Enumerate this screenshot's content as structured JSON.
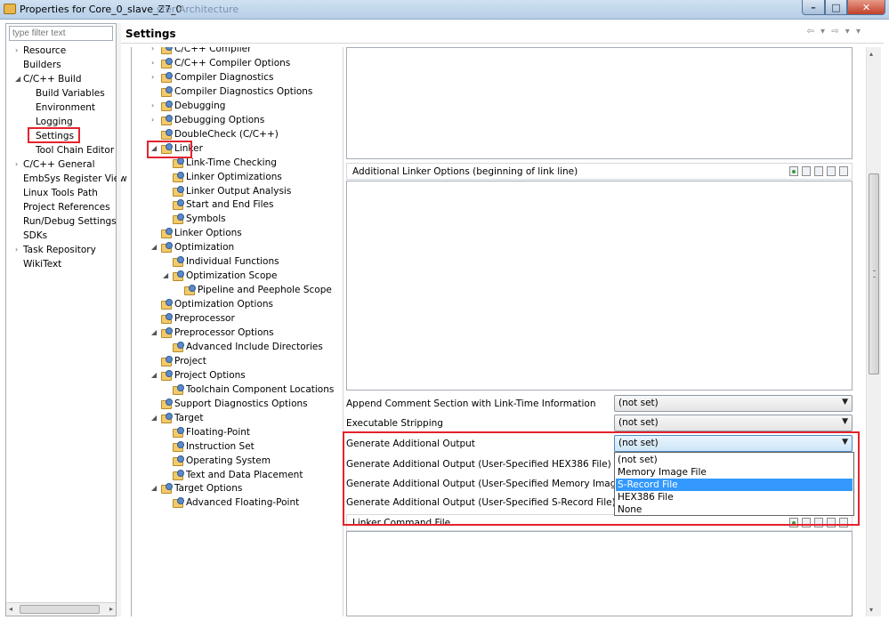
{
  "window": {
    "title": "Properties for Core_0_slave_Z7_0",
    "title_ghost": "ster Architecture",
    "min_glyph": "–",
    "max_glyph": "□",
    "close_glyph": "✕"
  },
  "filter": {
    "placeholder": "type filter text"
  },
  "nav_tree": [
    {
      "label": "Resource",
      "twisty": "›"
    },
    {
      "label": "Builders",
      "twisty": ""
    },
    {
      "label": "C/C++ Build",
      "twisty": "◢"
    },
    {
      "label": "Build Variables",
      "twisty": ""
    },
    {
      "label": "Environment",
      "twisty": ""
    },
    {
      "label": "Logging",
      "twisty": ""
    },
    {
      "label": "Settings",
      "twisty": "",
      "selected": true
    },
    {
      "label": "Tool Chain Editor",
      "twisty": ""
    },
    {
      "label": "C/C++ General",
      "twisty": "›"
    },
    {
      "label": "EmbSys Register View",
      "twisty": ""
    },
    {
      "label": "Linux Tools Path",
      "twisty": ""
    },
    {
      "label": "Project References",
      "twisty": ""
    },
    {
      "label": "Run/Debug Settings",
      "twisty": ""
    },
    {
      "label": "SDKs",
      "twisty": ""
    },
    {
      "label": "Task Repository",
      "twisty": "›"
    },
    {
      "label": "WikiText",
      "twisty": ""
    }
  ],
  "left_hscroll": {
    "left": "◂",
    "right": "▸"
  },
  "settings": {
    "title": "Settings",
    "nav_arrows": "⇦ ▾ ⇨ ▾ ▾"
  },
  "tool_tree": [
    {
      "label": "C/C++ Compiler",
      "twisty": "›",
      "level": 1
    },
    {
      "label": "C/C++ Compiler Options",
      "twisty": "›",
      "level": 1
    },
    {
      "label": "Compiler Diagnostics",
      "twisty": "›",
      "level": 1
    },
    {
      "label": "Compiler Diagnostics Options",
      "twisty": "",
      "level": 1
    },
    {
      "label": "Debugging",
      "twisty": "›",
      "level": 1
    },
    {
      "label": "Debugging Options",
      "twisty": "›",
      "level": 1
    },
    {
      "label": "DoubleCheck (C/C++)",
      "twisty": "",
      "level": 1
    },
    {
      "label": "Linker",
      "twisty": "◢",
      "level": 1
    },
    {
      "label": "Link-Time Checking",
      "twisty": "",
      "level": 2
    },
    {
      "label": "Linker Optimizations",
      "twisty": "",
      "level": 2
    },
    {
      "label": "Linker Output Analysis",
      "twisty": "",
      "level": 2
    },
    {
      "label": "Start and End Files",
      "twisty": "",
      "level": 2
    },
    {
      "label": "Symbols",
      "twisty": "",
      "level": 2
    },
    {
      "label": "Linker Options",
      "twisty": "",
      "level": 1
    },
    {
      "label": "Optimization",
      "twisty": "◢",
      "level": 1
    },
    {
      "label": "Individual Functions",
      "twisty": "",
      "level": 2
    },
    {
      "label": "Optimization Scope",
      "twisty": "◢",
      "level": 2
    },
    {
      "label": "Pipeline and Peephole Scope",
      "twisty": "",
      "level": 3
    },
    {
      "label": "Optimization Options",
      "twisty": "",
      "level": 1
    },
    {
      "label": "Preprocessor",
      "twisty": "",
      "level": 1
    },
    {
      "label": "Preprocessor Options",
      "twisty": "◢",
      "level": 1
    },
    {
      "label": "Advanced Include Directories",
      "twisty": "",
      "level": 2
    },
    {
      "label": "Project",
      "twisty": "",
      "level": 1
    },
    {
      "label": "Project Options",
      "twisty": "◢",
      "level": 1
    },
    {
      "label": "Toolchain Component Locations",
      "twisty": "",
      "level": 2
    },
    {
      "label": "Support Diagnostics Options",
      "twisty": "",
      "level": 1
    },
    {
      "label": "Target",
      "twisty": "◢",
      "level": 1
    },
    {
      "label": "Floating-Point",
      "twisty": "",
      "level": 2
    },
    {
      "label": "Instruction Set",
      "twisty": "",
      "level": 2
    },
    {
      "label": "Operating System",
      "twisty": "",
      "level": 2
    },
    {
      "label": "Text and Data Placement",
      "twisty": "",
      "level": 2
    },
    {
      "label": "Target Options",
      "twisty": "◢",
      "level": 1
    },
    {
      "label": "Advanced Floating-Point",
      "twisty": "",
      "level": 2
    }
  ],
  "page": {
    "additional_linker_options": "Additional Linker Options (beginning of link line)",
    "linker_command_file": "Linker Command File",
    "options": [
      {
        "label": "Append Comment Section with Link-Time Information",
        "value": "(not set)"
      },
      {
        "label": "Executable Stripping",
        "value": "(not set)"
      },
      {
        "label": "Generate Additional Output",
        "value": "(not set)"
      },
      {
        "label": "Generate Additional Output (User-Specified HEX386 File)",
        "value": ""
      },
      {
        "label": "Generate Additional Output (User-Specified Memory Image File)",
        "value": ""
      },
      {
        "label": "Generate Additional Output (User-Specified S-Record File)",
        "value": ""
      }
    ],
    "dropdown_arrow": "▼",
    "dropdown_options": [
      "(not set)",
      "Memory Image File",
      "S-Record File",
      "HEX386 File",
      "None"
    ],
    "dropdown_selected": "S-Record File"
  },
  "vscroll": {
    "up": "▴",
    "down": "▾"
  },
  "colors": {
    "highlight": "#e3232c",
    "selection": "#3399ff"
  }
}
